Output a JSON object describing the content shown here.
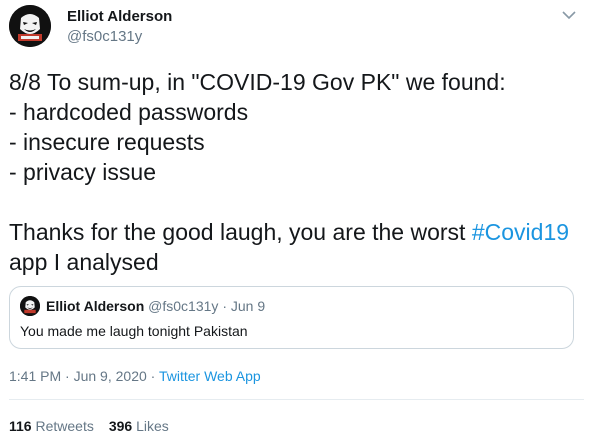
{
  "author": {
    "name": "Elliot Alderson",
    "handle": "@fs0c131y",
    "avatar_icon": "fsociety-mask-icon"
  },
  "tweet": {
    "lines": [
      "8/8 To sum-up, in \"COVID-19 Gov PK\" we found:",
      "- hardcoded passwords",
      "- insecure requests",
      "- privacy issue"
    ],
    "closing_prefix": "Thanks for the good laugh, you are the worst ",
    "hashtag": "#Covid19",
    "closing_suffix": "app I analysed"
  },
  "quoted_tweet": {
    "name": "Elliot Alderson",
    "handle": "@fs0c131y",
    "separator": "·",
    "date": "Jun 9",
    "text": "You made me laugh tonight Pakistan"
  },
  "meta": {
    "time": "1:41 PM",
    "date": "Jun 9, 2020",
    "separator": "·",
    "source": "Twitter Web App"
  },
  "stats": {
    "retweets_count": "116",
    "retweets_label": "Retweets",
    "likes_count": "396",
    "likes_label": "Likes"
  },
  "colors": {
    "link": "#1b95e0",
    "secondary_text": "#657786",
    "border": "#ccd6dd"
  }
}
